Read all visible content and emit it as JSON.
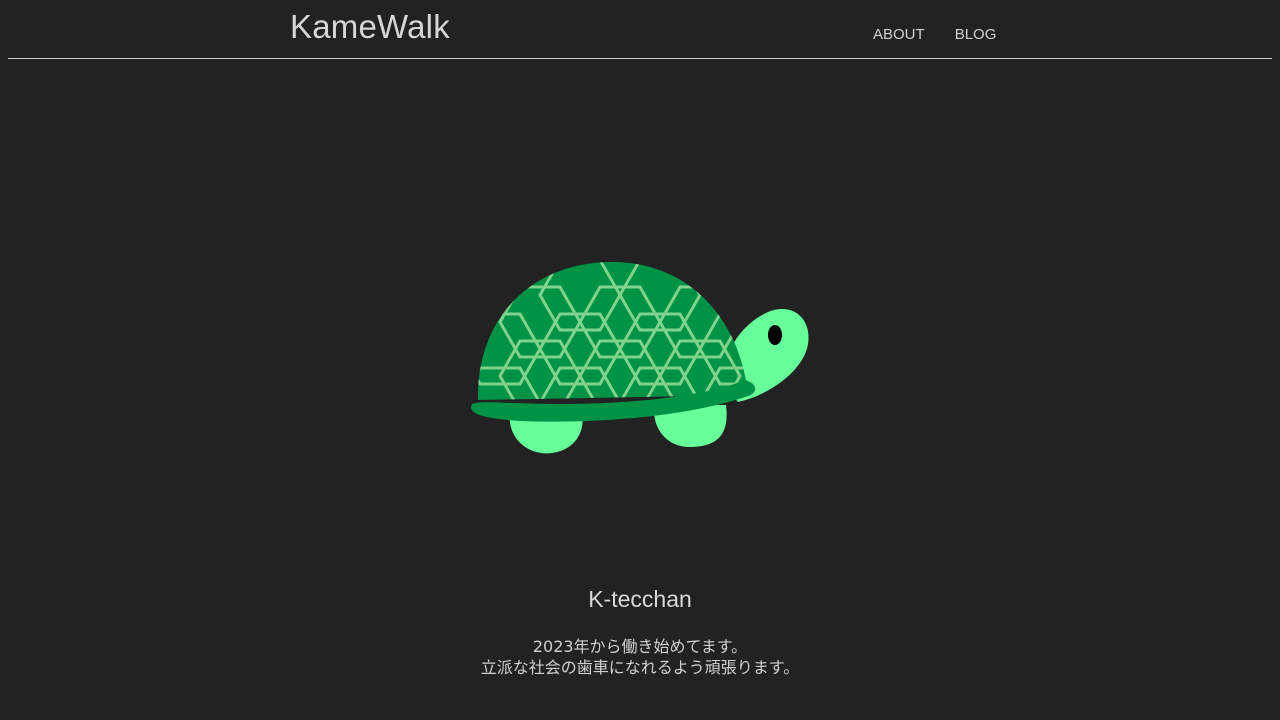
{
  "header": {
    "site_title": "KameWalk",
    "nav": [
      {
        "label": "ABOUT"
      },
      {
        "label": "BLOG"
      }
    ]
  },
  "profile": {
    "name": "K-tecchan",
    "bio_lines": [
      "2023年から働き始めてます。",
      "立派な社会の歯車になれるよう頑張ります。"
    ]
  },
  "colors": {
    "background": "#222222",
    "shell": "#009245",
    "shell_lines": "#7fd38d",
    "skin": "#66ff99"
  },
  "icons": {
    "hero": "turtle-icon"
  }
}
